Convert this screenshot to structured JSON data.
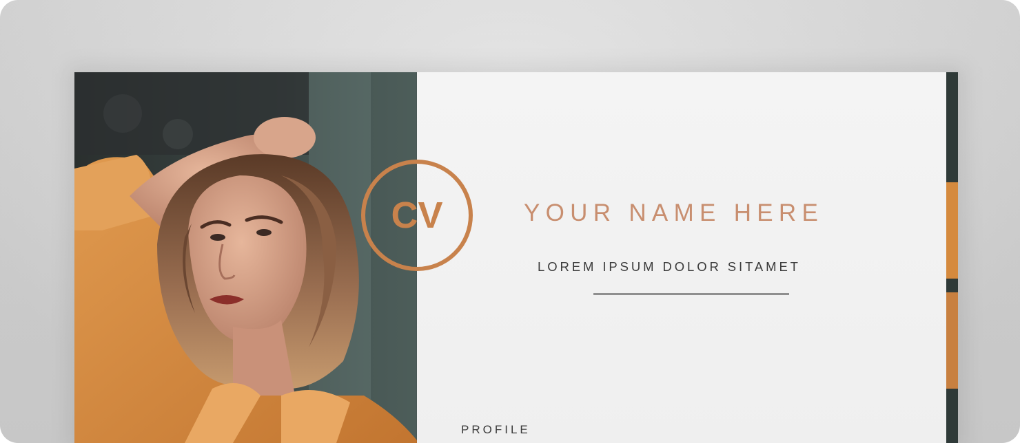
{
  "resume": {
    "logo_text": "CV",
    "name": "YOUR NAME HERE",
    "subtitle": "LOREM IPSUM DOLOR SITAMET",
    "profile_heading": "PROFILE"
  },
  "colors": {
    "accent": "#c8824c",
    "name_text": "#c88e6f",
    "body_text": "#3b3b3b",
    "divider": "#8f8f8f",
    "page_bg": "#f1f1f1",
    "photo_shirt": "#d58a3e",
    "photo_bg": "#2f3a38"
  },
  "icons": {
    "logo": "cv-monogram-circle-icon"
  }
}
